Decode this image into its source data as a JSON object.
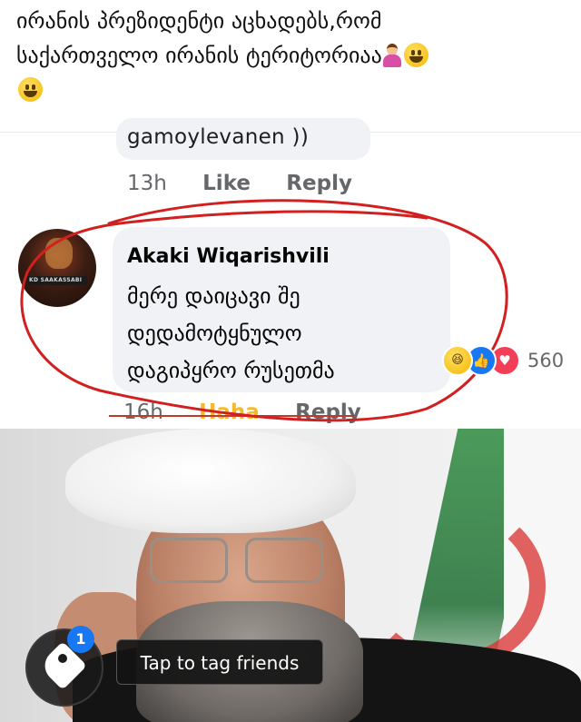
{
  "post": {
    "caption_line1": "ირანის პრეზიდენტი აცხადებს,რომ",
    "caption_line2": "საქართველო ირანის ტერიტორიაა"
  },
  "previous_comment": {
    "text_fragment": "gamoylevanen ))",
    "time": "13h",
    "like_label": "Like",
    "reply_label": "Reply"
  },
  "comment": {
    "author": "Akaki Wiqarishvili",
    "avatar_label": "KD SAAKASSABI",
    "lines": [
      "მერე დაიცავი შე",
      "დედამოტყნულო",
      "დაგიპყრო რუსეთმა"
    ],
    "reaction_count": "560",
    "time": "16h",
    "reaction_label": "Haha",
    "reply_label": "Reply"
  },
  "photo": {
    "tag_badge_count": "1",
    "tag_tooltip": "Tap to tag friends"
  },
  "colors": {
    "bubble": "#f0f2f5",
    "haha": "#f7b928",
    "like_blue": "#1877f2",
    "love_red": "#f33e58",
    "annotation_red": "#d21f1f"
  },
  "icons": [
    "grinning-face-icon",
    "person-shrugging-icon",
    "haha-reaction-icon",
    "like-reaction-icon",
    "love-reaction-icon",
    "tag-icon"
  ]
}
